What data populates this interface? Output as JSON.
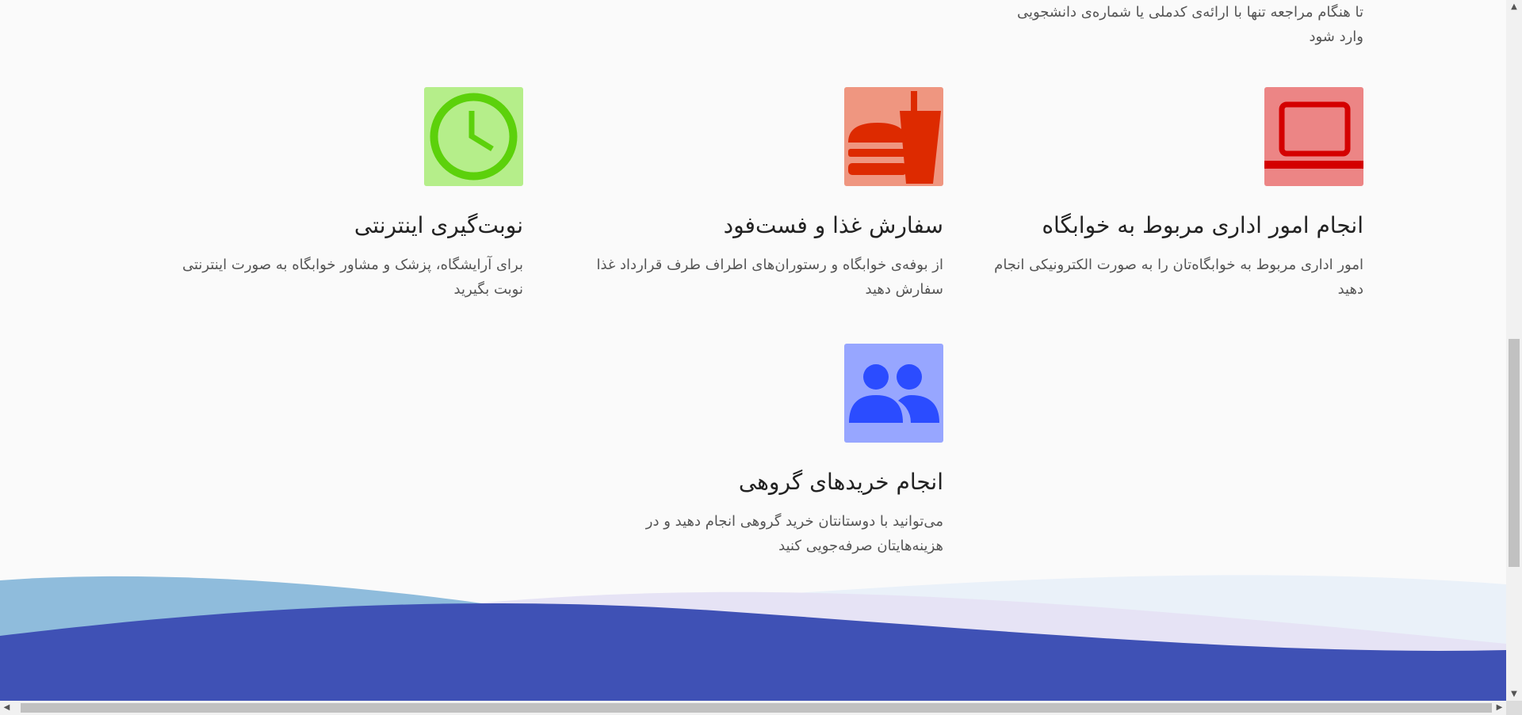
{
  "top_text": {
    "line1": "تا هنگام مراجعه تنها با ارائه‌ی کدملی یا شماره‌ی دانشجویی",
    "line2": "وارد شود"
  },
  "features": [
    {
      "title": "انجام امور اداری مربوط به خوابگاه",
      "desc_line1": "امور اداری مربوط به خوابگاه‌تان را به صورت الکترونیکی انجام",
      "desc_line2": "دهید",
      "icon": "laptop-icon",
      "bg_color": "#ec8585",
      "fg_color": "#d40000"
    },
    {
      "title": "سفارش غذا و فست‌فود",
      "desc_line1": "از بوفه‌ی خوابگاه و رستوران‌های اطراف طرف قرارداد غذا",
      "desc_line2": "سفارش دهید",
      "icon": "fastfood-icon",
      "bg_color": "#ef9680",
      "fg_color": "#dd2a00"
    },
    {
      "title": "نوبت‌گیری اینترنتی",
      "desc_line1": "برای آرایشگاه، پزشک و مشاور خوابگاه به صورت اینترنتی",
      "desc_line2": "نوبت بگیرید",
      "icon": "clock-icon",
      "bg_color": "#b5ee8a",
      "fg_color": "#5cd10b"
    },
    {
      "title": "انجام خریدهای گروهی",
      "desc_line1": "می‌توانید با دوستانتان خرید گروهی انجام دهید و در",
      "desc_line2": "هزینه‌هایتان صرفه‌جویی کنید",
      "icon": "group-icon",
      "bg_color": "#97a6ff",
      "fg_color": "#2b4cff"
    }
  ],
  "colors": {
    "wave_dark": "#3f51b5",
    "wave_light_blue": "#8fbcdc",
    "wave_lavender": "#e6e3f5",
    "wave_pale": "#eaf1f9"
  },
  "scrollbars": {
    "up_arrow_icon": "▲",
    "down_arrow_icon": "▼",
    "left_arrow_icon": "◀",
    "right_arrow_icon": "▶"
  }
}
